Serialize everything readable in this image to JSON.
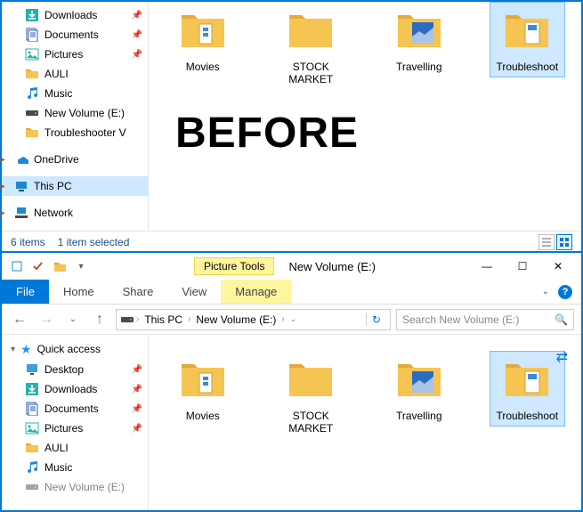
{
  "overlay": {
    "before_label": "BEFORE"
  },
  "top": {
    "sidebar": {
      "items": [
        {
          "label": "Downloads",
          "pinned": true,
          "icon": "downloads"
        },
        {
          "label": "Documents",
          "pinned": true,
          "icon": "documents"
        },
        {
          "label": "Pictures",
          "pinned": true,
          "icon": "pictures"
        },
        {
          "label": "AULI",
          "pinned": false,
          "icon": "folder"
        },
        {
          "label": "Music",
          "pinned": false,
          "icon": "music"
        },
        {
          "label": "New Volume (E:)",
          "pinned": false,
          "icon": "drive"
        },
        {
          "label": "Troubleshooter V",
          "pinned": false,
          "icon": "folder"
        }
      ],
      "onedrive": {
        "label": "OneDrive"
      },
      "thispc": {
        "label": "This PC",
        "selected": true
      },
      "network": {
        "label": "Network"
      }
    },
    "folders": [
      {
        "label": "Movies"
      },
      {
        "label": "STOCK MARKET"
      },
      {
        "label": "Travelling"
      },
      {
        "label": "Troubleshoot",
        "selected": true
      }
    ],
    "status": {
      "items": "6 items",
      "selection": "1 item selected"
    }
  },
  "bot": {
    "title": "New Volume (E:)",
    "context_tab_group": "Picture Tools",
    "tabs": {
      "file": "File",
      "home": "Home",
      "share": "Share",
      "view": "View",
      "manage": "Manage"
    },
    "breadcrumbs": {
      "root": "This PC",
      "current": "New Volume (E:)"
    },
    "search_placeholder": "Search New Volume (E:)",
    "sidebar": {
      "quick_access": "Quick access",
      "items": [
        {
          "label": "Desktop",
          "pinned": true,
          "icon": "desktop"
        },
        {
          "label": "Downloads",
          "pinned": true,
          "icon": "downloads"
        },
        {
          "label": "Documents",
          "pinned": true,
          "icon": "documents"
        },
        {
          "label": "Pictures",
          "pinned": true,
          "icon": "pictures"
        },
        {
          "label": "AULI",
          "pinned": false,
          "icon": "folder"
        },
        {
          "label": "Music",
          "pinned": false,
          "icon": "music"
        },
        {
          "label": "New Volume (E:)",
          "pinned": false,
          "icon": "drive"
        }
      ]
    },
    "folders": [
      {
        "label": "Movies"
      },
      {
        "label": "STOCK MARKET"
      },
      {
        "label": "Travelling"
      },
      {
        "label": "Troubleshoot",
        "selected": true
      }
    ]
  }
}
